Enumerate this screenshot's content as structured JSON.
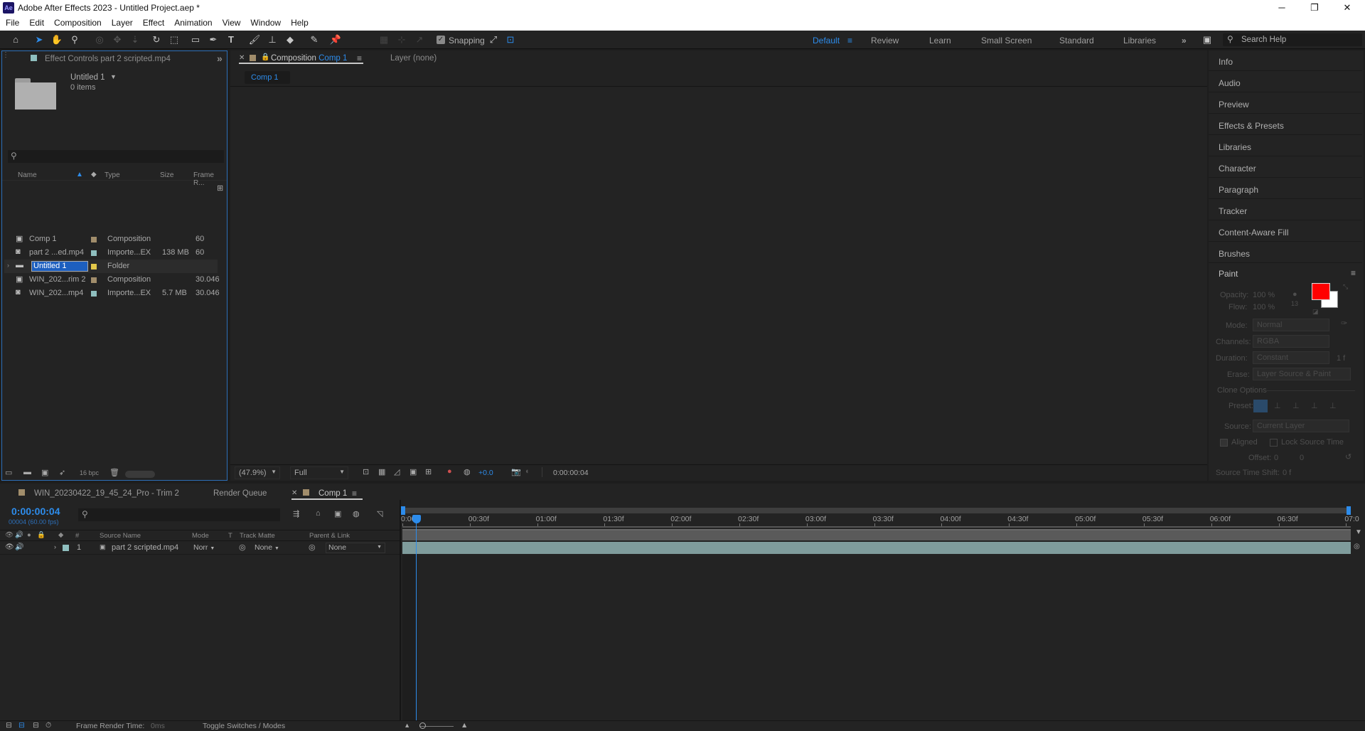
{
  "app": {
    "logo": "Ae",
    "title": "Adobe After Effects 2023 - Untitled Project.aep *"
  },
  "window_controls": {
    "minimize": "─",
    "maximize": "❐",
    "close": "✕"
  },
  "menu": [
    "File",
    "Edit",
    "Composition",
    "Layer",
    "Effect",
    "Animation",
    "View",
    "Window",
    "Help"
  ],
  "toolbar": {
    "snapping_label": "Snapping",
    "workspaces": [
      "Default",
      "Review",
      "Learn",
      "Small Screen",
      "Standard",
      "Libraries"
    ],
    "active_workspace": "Default",
    "more": "»",
    "search_help": "Search Help"
  },
  "project_panel": {
    "tab_title": "Effect Controls part 2 scripted.mp4",
    "more": "»",
    "folder_name": "Untitled 1",
    "folder_items": "0 items",
    "columns": [
      "Name",
      "Type",
      "Size",
      "Frame R..."
    ],
    "rows": [
      {
        "name": "Comp 1",
        "type": "Composition",
        "size": "",
        "fps": "60",
        "color": "#a18d6b",
        "icon": "comp-icon"
      },
      {
        "name": "part 2 ...ed.mp4",
        "type": "Importe...EX",
        "size": "138 MB",
        "fps": "60",
        "color": "#8fbfbf",
        "icon": "footage-icon"
      },
      {
        "name": "Untitled 1",
        "type": "Folder",
        "size": "",
        "fps": "",
        "color": "#e3c84a",
        "icon": "folder-icon"
      },
      {
        "name": "WIN_202...rim 2",
        "type": "Composition",
        "size": "",
        "fps": "30.046",
        "color": "#a18d6b",
        "icon": "comp-icon"
      },
      {
        "name": "WIN_202...mp4",
        "type": "Importe...EX",
        "size": "5.7 MB",
        "fps": "30.046",
        "color": "#8fbfbf",
        "icon": "footage-icon"
      }
    ],
    "bpc": "16 bpc"
  },
  "comp_panel": {
    "tab_prefix": "Composition",
    "tab_comp": "Comp 1",
    "layer_tab": "Layer (none)",
    "breadcrumb": "Comp 1",
    "zoom": "(47.9%)",
    "resolution": "Full",
    "exposure": "+0.0",
    "timecode": "0:00:00:04"
  },
  "right_panels": [
    "Info",
    "Audio",
    "Preview",
    "Effects & Presets",
    "Libraries",
    "Character",
    "Paragraph",
    "Tracker",
    "Content-Aware Fill",
    "Brushes"
  ],
  "paint": {
    "title": "Paint",
    "opacity_label": "Opacity:",
    "opacity": "100 %",
    "flow_label": "Flow:",
    "flow": "100 %",
    "brush_size": "13",
    "mode_label": "Mode:",
    "mode": "Normal",
    "channels_label": "Channels:",
    "channels": "RGBA",
    "duration_label": "Duration:",
    "duration": "Constant",
    "duration_value": "1 f",
    "erase_label": "Erase:",
    "erase": "Layer Source & Paint",
    "clone_options": "Clone Options",
    "preset_label": "Preset:",
    "source_label": "Source:",
    "source": "Current Layer",
    "aligned": "Aligned",
    "lock_source_time": "Lock Source Time",
    "offset_label": "Offset:",
    "offset_x": "0",
    "offset_y": "0",
    "source_time_shift_label": "Source Time Shift:",
    "source_time_shift": "0 f",
    "fg_color": "#ff0000",
    "bg_color": "#ffffff"
  },
  "timeline": {
    "tabs": [
      "WIN_20230422_19_45_24_Pro - Trim 2",
      "Render Queue",
      "Comp 1"
    ],
    "active_tab": "Comp 1",
    "timecode": "0:00:00:04",
    "frame_info": "00004 (60.00 fps)",
    "columns": [
      "#",
      "Source Name",
      "Mode",
      "T",
      "Track Matte",
      "Parent & Link"
    ],
    "layer": {
      "num": "1",
      "name": "part 2 scripted.mp4",
      "mode": "Norr",
      "matte": "None",
      "parent": "None",
      "color": "#8fbfbf"
    },
    "ruler": [
      "0:00f",
      "00:30f",
      "01:00f",
      "01:30f",
      "02:00f",
      "02:30f",
      "03:00f",
      "03:30f",
      "04:00f",
      "04:30f",
      "05:00f",
      "05:30f",
      "06:00f",
      "06:30f",
      "07:0"
    ],
    "frame_render_label": "Frame Render Time:",
    "frame_render_value": "0ms",
    "toggle_label": "Toggle Switches / Modes"
  }
}
